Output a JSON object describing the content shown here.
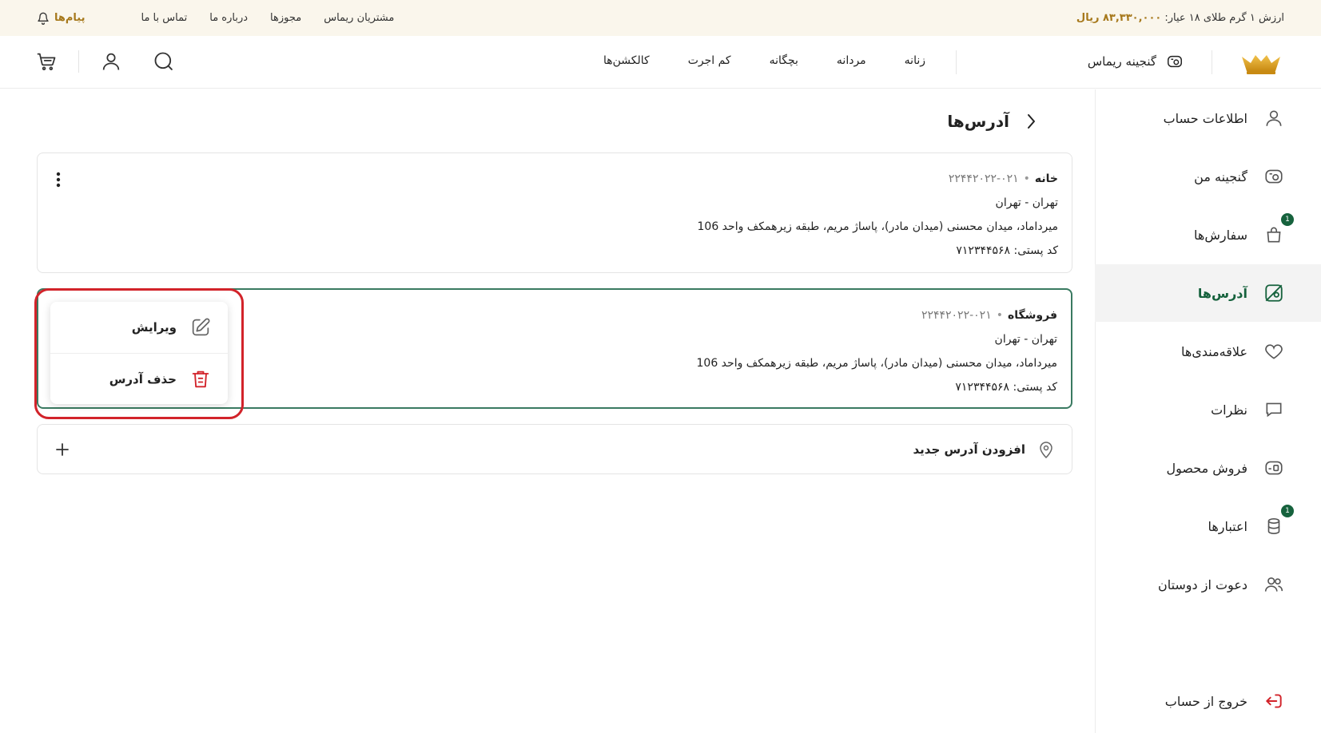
{
  "topbar": {
    "gold_label": "ارزش ۱ گرم طلای ۱۸ عیار:",
    "gold_value": "۸۳,۳۳۰,۰۰۰ ریال",
    "links": [
      "مشتریان ریماس",
      "مجوزها",
      "درباره ما",
      "تماس با ما"
    ],
    "messages": "پیام‌ها"
  },
  "header": {
    "treasure": "گنجینه ریماس",
    "nav": [
      "زنانه",
      "مردانه",
      "بچگانه",
      "کم اجرت",
      "کالکشن‌ها"
    ]
  },
  "sidebar": {
    "items": [
      {
        "label": "اطلاعات حساب",
        "icon": "user-icon",
        "badge": ""
      },
      {
        "label": "گنجینه من",
        "icon": "treasure-icon",
        "badge": ""
      },
      {
        "label": "سفارش‌ها",
        "icon": "bag-icon",
        "badge": "1"
      },
      {
        "label": "آدرس‌ها",
        "icon": "map-icon",
        "badge": "",
        "active": true
      },
      {
        "label": "علاقه‌مندی‌ها",
        "icon": "heart-icon",
        "badge": ""
      },
      {
        "label": "نظرات",
        "icon": "comment-icon",
        "badge": ""
      },
      {
        "label": "فروش محصول",
        "icon": "sell-icon",
        "badge": ""
      },
      {
        "label": "اعتبارها",
        "icon": "coins-icon",
        "badge": "1"
      },
      {
        "label": "دعوت از دوستان",
        "icon": "users-icon",
        "badge": ""
      }
    ],
    "logout": "خروج از حساب"
  },
  "page": {
    "title": "آدرس‌ها"
  },
  "addresses": [
    {
      "name": "خانه",
      "phone": "۰۲۱-۲۲۴۴۲۰۲۲",
      "city": "تهران - تهران",
      "street": "میرداماد، میدان محسنی (میدان مادر)، پاساژ مریم، طبقه زیرهمکف واحد 106",
      "postal": "کد پستی: ۷۱۲۳۴۴۵۶۸"
    },
    {
      "name": "فروشگاه",
      "phone": "۰۲۱-۲۲۴۴۲۰۲۲",
      "city": "تهران - تهران",
      "street": "میرداماد، میدان محسنی (میدان مادر)، پاساژ مریم، طبقه زیرهمکف واحد 106",
      "postal": "کد پستی: ۷۱۲۳۴۴۵۶۸"
    }
  ],
  "menu": {
    "edit": "ویرایش",
    "delete": "حذف آدرس"
  },
  "add_address": "افزودن آدرس جدید",
  "colors": {
    "accent": "#16623d",
    "gold": "#a6781b",
    "highlight": "#d2232a",
    "delete": "#d2232a"
  }
}
